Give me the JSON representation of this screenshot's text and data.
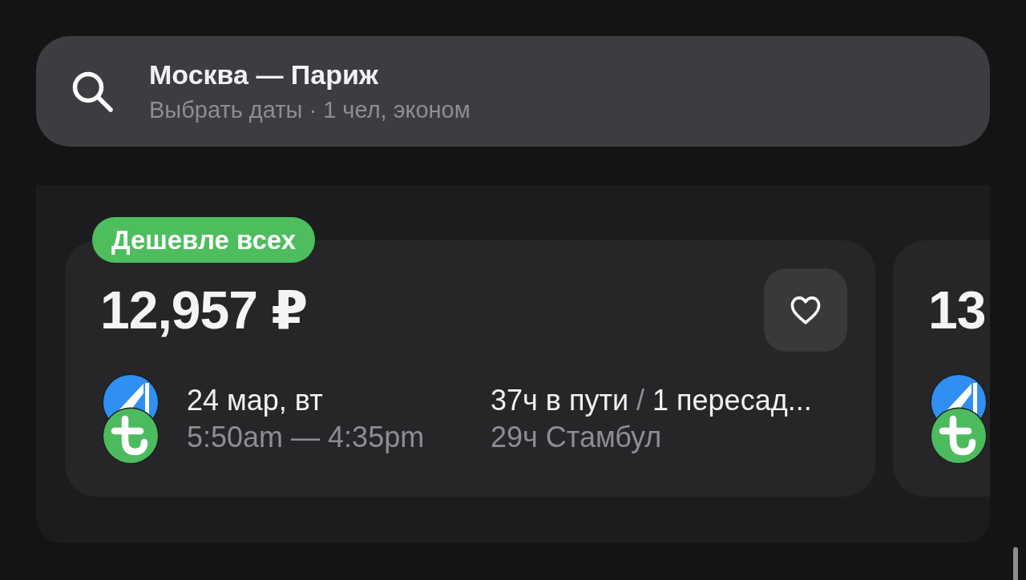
{
  "search": {
    "title": "Москва — Париж",
    "details": "Выбрать даты · 1 чел, эконом"
  },
  "flights": [
    {
      "badge": "Дешевле всех",
      "price": "12,957 ₽",
      "favorite": false,
      "airlines": [
        {
          "kind": "sail",
          "color": "#2f8ff2"
        },
        {
          "kind": "t",
          "color": "#4cbb5d"
        }
      ],
      "date": "24 мар, вт",
      "times": "5:50am — 4:35pm",
      "duration": "37ч в пути",
      "separator": "/",
      "stops": "1 пересад...",
      "layover": "29ч Стамбул"
    },
    {
      "price": "13",
      "airlines": [
        {
          "kind": "sail",
          "color": "#2f8ff2"
        },
        {
          "kind": "t",
          "color": "#4cbb5d"
        }
      ]
    }
  ]
}
